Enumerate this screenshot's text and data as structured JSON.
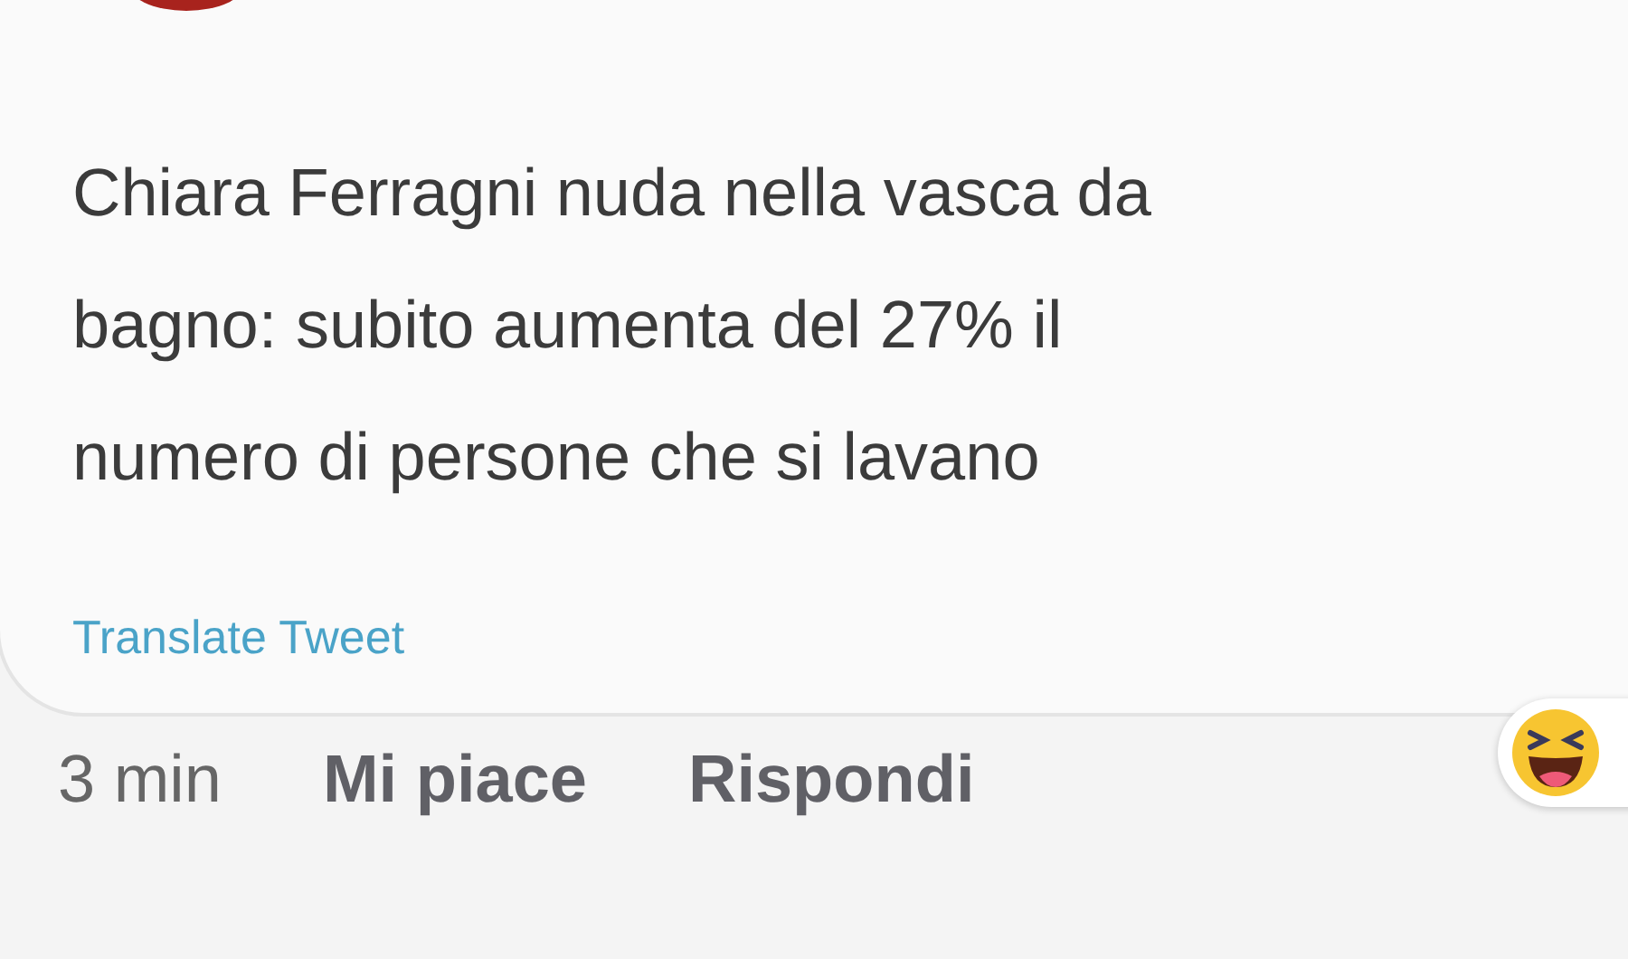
{
  "comment": {
    "text_lines": [
      "Chiara Ferragni nuda nella vasca da",
      "bagno: subito aumenta del 27% il",
      "numero di persone che si lavano"
    ],
    "translate_link": "Translate Tweet"
  },
  "actions": {
    "time": "3 min",
    "like": "Mi piace",
    "reply": "Rispondi"
  }
}
